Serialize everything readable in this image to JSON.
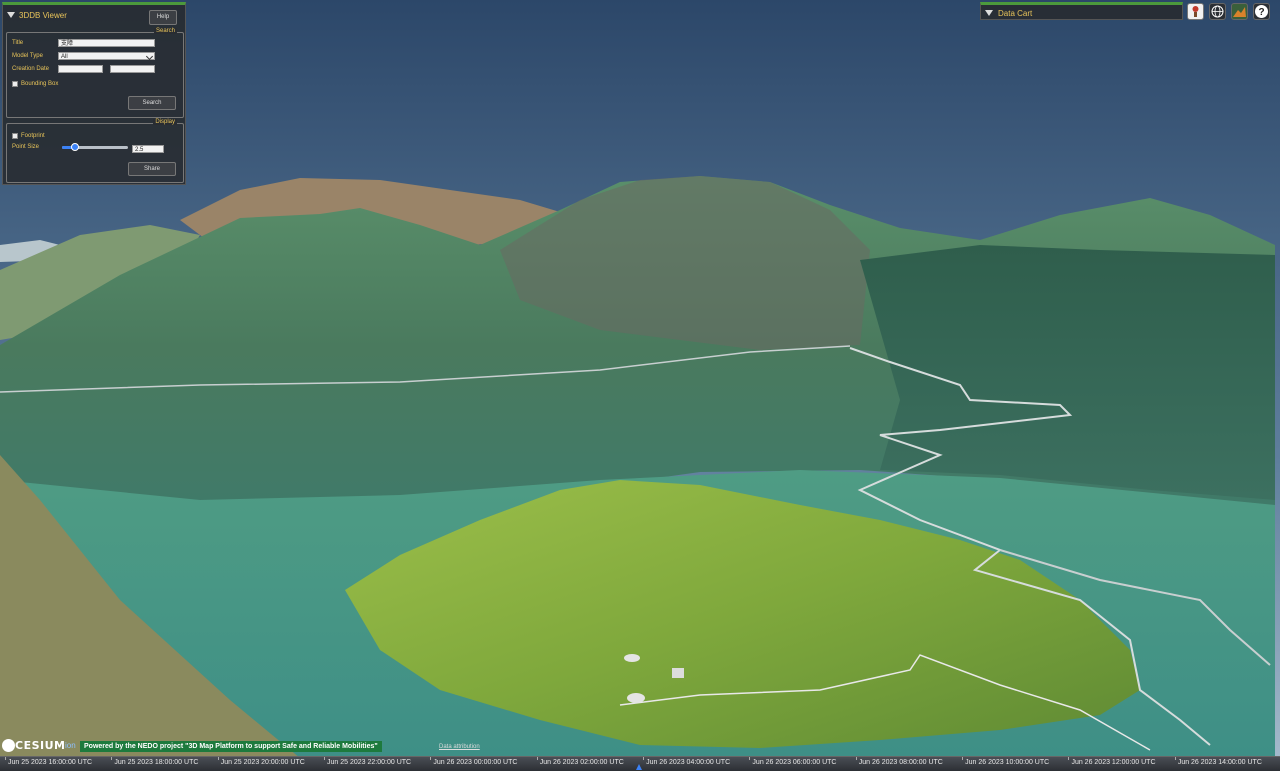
{
  "viewer": {
    "title": "3DDB Viewer",
    "help_label": "Help"
  },
  "search": {
    "legend": "Search",
    "title_label": "Title",
    "title_value": "支障",
    "model_type_label": "Model Type",
    "model_type_value": "All",
    "creation_date_label": "Creation Date",
    "creation_date_from": "",
    "creation_date_to": "",
    "bounding_box_label": "Bounding Box",
    "bounding_box_checked": false,
    "search_button": "Search"
  },
  "display": {
    "legend": "Display",
    "footprint_label": "Footprint",
    "footprint_checked": false,
    "point_size_label": "Point Size",
    "point_size_value": "2.5",
    "point_size_fraction": 0.2,
    "share_button": "Share"
  },
  "data_cart": {
    "title": "Data Cart"
  },
  "toolbar": {
    "icons": [
      "geocoder-icon",
      "globe-icon",
      "base-layer-picker-icon",
      "help-icon"
    ],
    "help_glyph": "?"
  },
  "credits": {
    "cesium": "CESIUM",
    "ion": "ion",
    "nedo": "Powered by the NEDO project \"3D Map Platform to support Safe and Reliable Mobilities\"",
    "attribution": "Data attribution"
  },
  "timeline": {
    "labels": [
      "Jun 25 2023 16:00:00 UTC",
      "Jun 25 2023 18:00:00 UTC",
      "Jun 25 2023 20:00:00 UTC",
      "Jun 25 2023 22:00:00 UTC",
      "Jun 26 2023 00:00:00 UTC",
      "Jun 26 2023 02:00:00 UTC",
      "Jun 26 2023 04:00:00 UTC",
      "Jun 26 2023 06:00:00 UTC",
      "Jun 26 2023 08:00:00 UTC",
      "Jun 26 2023 10:00:00 UTC",
      "Jun 26 2023 12:00:00 UTC",
      "Jun 26 2023 14:00:00 UTC"
    ]
  },
  "colors": {
    "accent": "#e8c45a",
    "panel_border": "#4c9a3c",
    "nedo_bg": "#1d7a3d",
    "sky_top": "#2f4a6e",
    "sky_bottom": "#8da7bf",
    "terrain_teal": "#4a9a8a",
    "terrain_green": "#7cab45"
  }
}
